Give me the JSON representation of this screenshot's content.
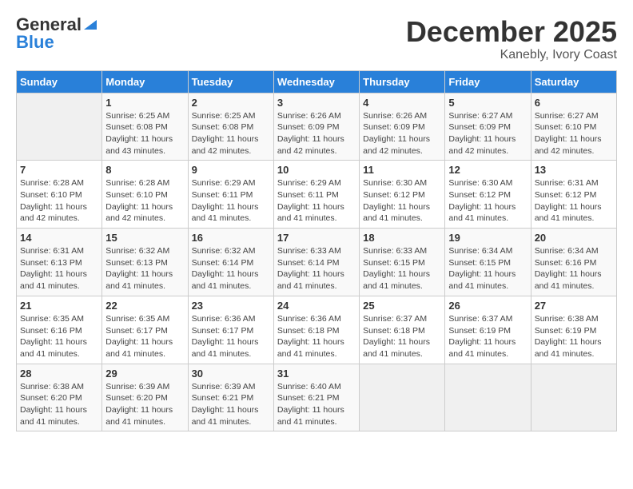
{
  "logo": {
    "general": "General",
    "blue": "Blue"
  },
  "title": "December 2025",
  "location": "Kanebly, Ivory Coast",
  "days_of_week": [
    "Sunday",
    "Monday",
    "Tuesday",
    "Wednesday",
    "Thursday",
    "Friday",
    "Saturday"
  ],
  "weeks": [
    [
      {
        "num": "",
        "sunrise": "",
        "sunset": "",
        "daylight": ""
      },
      {
        "num": "1",
        "sunrise": "Sunrise: 6:25 AM",
        "sunset": "Sunset: 6:08 PM",
        "daylight": "Daylight: 11 hours and 43 minutes."
      },
      {
        "num": "2",
        "sunrise": "Sunrise: 6:25 AM",
        "sunset": "Sunset: 6:08 PM",
        "daylight": "Daylight: 11 hours and 42 minutes."
      },
      {
        "num": "3",
        "sunrise": "Sunrise: 6:26 AM",
        "sunset": "Sunset: 6:09 PM",
        "daylight": "Daylight: 11 hours and 42 minutes."
      },
      {
        "num": "4",
        "sunrise": "Sunrise: 6:26 AM",
        "sunset": "Sunset: 6:09 PM",
        "daylight": "Daylight: 11 hours and 42 minutes."
      },
      {
        "num": "5",
        "sunrise": "Sunrise: 6:27 AM",
        "sunset": "Sunset: 6:09 PM",
        "daylight": "Daylight: 11 hours and 42 minutes."
      },
      {
        "num": "6",
        "sunrise": "Sunrise: 6:27 AM",
        "sunset": "Sunset: 6:10 PM",
        "daylight": "Daylight: 11 hours and 42 minutes."
      }
    ],
    [
      {
        "num": "7",
        "sunrise": "Sunrise: 6:28 AM",
        "sunset": "Sunset: 6:10 PM",
        "daylight": "Daylight: 11 hours and 42 minutes."
      },
      {
        "num": "8",
        "sunrise": "Sunrise: 6:28 AM",
        "sunset": "Sunset: 6:10 PM",
        "daylight": "Daylight: 11 hours and 42 minutes."
      },
      {
        "num": "9",
        "sunrise": "Sunrise: 6:29 AM",
        "sunset": "Sunset: 6:11 PM",
        "daylight": "Daylight: 11 hours and 41 minutes."
      },
      {
        "num": "10",
        "sunrise": "Sunrise: 6:29 AM",
        "sunset": "Sunset: 6:11 PM",
        "daylight": "Daylight: 11 hours and 41 minutes."
      },
      {
        "num": "11",
        "sunrise": "Sunrise: 6:30 AM",
        "sunset": "Sunset: 6:12 PM",
        "daylight": "Daylight: 11 hours and 41 minutes."
      },
      {
        "num": "12",
        "sunrise": "Sunrise: 6:30 AM",
        "sunset": "Sunset: 6:12 PM",
        "daylight": "Daylight: 11 hours and 41 minutes."
      },
      {
        "num": "13",
        "sunrise": "Sunrise: 6:31 AM",
        "sunset": "Sunset: 6:12 PM",
        "daylight": "Daylight: 11 hours and 41 minutes."
      }
    ],
    [
      {
        "num": "14",
        "sunrise": "Sunrise: 6:31 AM",
        "sunset": "Sunset: 6:13 PM",
        "daylight": "Daylight: 11 hours and 41 minutes."
      },
      {
        "num": "15",
        "sunrise": "Sunrise: 6:32 AM",
        "sunset": "Sunset: 6:13 PM",
        "daylight": "Daylight: 11 hours and 41 minutes."
      },
      {
        "num": "16",
        "sunrise": "Sunrise: 6:32 AM",
        "sunset": "Sunset: 6:14 PM",
        "daylight": "Daylight: 11 hours and 41 minutes."
      },
      {
        "num": "17",
        "sunrise": "Sunrise: 6:33 AM",
        "sunset": "Sunset: 6:14 PM",
        "daylight": "Daylight: 11 hours and 41 minutes."
      },
      {
        "num": "18",
        "sunrise": "Sunrise: 6:33 AM",
        "sunset": "Sunset: 6:15 PM",
        "daylight": "Daylight: 11 hours and 41 minutes."
      },
      {
        "num": "19",
        "sunrise": "Sunrise: 6:34 AM",
        "sunset": "Sunset: 6:15 PM",
        "daylight": "Daylight: 11 hours and 41 minutes."
      },
      {
        "num": "20",
        "sunrise": "Sunrise: 6:34 AM",
        "sunset": "Sunset: 6:16 PM",
        "daylight": "Daylight: 11 hours and 41 minutes."
      }
    ],
    [
      {
        "num": "21",
        "sunrise": "Sunrise: 6:35 AM",
        "sunset": "Sunset: 6:16 PM",
        "daylight": "Daylight: 11 hours and 41 minutes."
      },
      {
        "num": "22",
        "sunrise": "Sunrise: 6:35 AM",
        "sunset": "Sunset: 6:17 PM",
        "daylight": "Daylight: 11 hours and 41 minutes."
      },
      {
        "num": "23",
        "sunrise": "Sunrise: 6:36 AM",
        "sunset": "Sunset: 6:17 PM",
        "daylight": "Daylight: 11 hours and 41 minutes."
      },
      {
        "num": "24",
        "sunrise": "Sunrise: 6:36 AM",
        "sunset": "Sunset: 6:18 PM",
        "daylight": "Daylight: 11 hours and 41 minutes."
      },
      {
        "num": "25",
        "sunrise": "Sunrise: 6:37 AM",
        "sunset": "Sunset: 6:18 PM",
        "daylight": "Daylight: 11 hours and 41 minutes."
      },
      {
        "num": "26",
        "sunrise": "Sunrise: 6:37 AM",
        "sunset": "Sunset: 6:19 PM",
        "daylight": "Daylight: 11 hours and 41 minutes."
      },
      {
        "num": "27",
        "sunrise": "Sunrise: 6:38 AM",
        "sunset": "Sunset: 6:19 PM",
        "daylight": "Daylight: 11 hours and 41 minutes."
      }
    ],
    [
      {
        "num": "28",
        "sunrise": "Sunrise: 6:38 AM",
        "sunset": "Sunset: 6:20 PM",
        "daylight": "Daylight: 11 hours and 41 minutes."
      },
      {
        "num": "29",
        "sunrise": "Sunrise: 6:39 AM",
        "sunset": "Sunset: 6:20 PM",
        "daylight": "Daylight: 11 hours and 41 minutes."
      },
      {
        "num": "30",
        "sunrise": "Sunrise: 6:39 AM",
        "sunset": "Sunset: 6:21 PM",
        "daylight": "Daylight: 11 hours and 41 minutes."
      },
      {
        "num": "31",
        "sunrise": "Sunrise: 6:40 AM",
        "sunset": "Sunset: 6:21 PM",
        "daylight": "Daylight: 11 hours and 41 minutes."
      },
      {
        "num": "",
        "sunrise": "",
        "sunset": "",
        "daylight": ""
      },
      {
        "num": "",
        "sunrise": "",
        "sunset": "",
        "daylight": ""
      },
      {
        "num": "",
        "sunrise": "",
        "sunset": "",
        "daylight": ""
      }
    ]
  ]
}
